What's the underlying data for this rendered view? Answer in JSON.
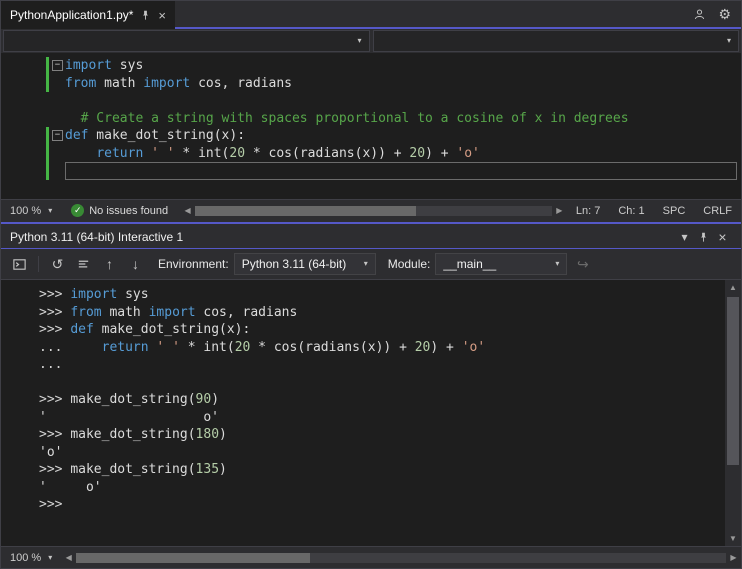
{
  "colors": {
    "accent": "#5558c8",
    "chrome": "#2d2d30",
    "editor_bg": "#1e1e1e",
    "border": "#3f3f46",
    "keyword": "#569cd6",
    "string": "#d69d85",
    "number": "#b5cea8",
    "comment": "#57a64a",
    "code_text": "#dcdcdc",
    "status_green": "#388a34",
    "change_bar": "#45b545"
  },
  "glyphs": {
    "caret_down": "▾",
    "close": "×",
    "gear": "⚙",
    "reset": "↺",
    "arrow_up": "↑",
    "arrow_down": "↓",
    "send_arrow": "↪",
    "scroll_left": "◀",
    "scroll_right": "▶",
    "scroll_up": "▲",
    "scroll_down": "▼",
    "check": "✓",
    "fold_collapse": "−"
  },
  "editor_tab": {
    "title": "PythonApplication1.py*"
  },
  "editor": {
    "lines": [
      {
        "fold": true,
        "changed": true,
        "tokens": [
          [
            "k",
            "import"
          ],
          [
            "d",
            " sys"
          ]
        ]
      },
      {
        "changed": true,
        "tokens": [
          [
            "k",
            "from"
          ],
          [
            "d",
            " math "
          ],
          [
            "k",
            "import"
          ],
          [
            "d",
            " cos, radians"
          ]
        ]
      },
      {
        "tokens": []
      },
      {
        "tokens": [
          [
            "c",
            "  # Create a string with spaces proportional to a cosine of x in degrees"
          ]
        ]
      },
      {
        "fold": true,
        "changed": true,
        "tokens": [
          [
            "k",
            "def"
          ],
          [
            "d",
            " make_dot_string(x):"
          ]
        ]
      },
      {
        "changed": true,
        "tokens": [
          [
            "d",
            "    "
          ],
          [
            "k",
            "return"
          ],
          [
            "d",
            " "
          ],
          [
            "s",
            "' '"
          ],
          [
            "d",
            " * int("
          ],
          [
            "n",
            "20"
          ],
          [
            "d",
            " * cos(radians(x)) + "
          ],
          [
            "n",
            "20"
          ],
          [
            "d",
            ") + "
          ],
          [
            "s",
            "'o'"
          ]
        ]
      },
      {
        "changed": true,
        "caretBox": true,
        "tokens": []
      }
    ],
    "status": {
      "zoom": "100 %",
      "issues_message": "No issues found",
      "line": "Ln: 7",
      "column": "Ch: 1",
      "indent_mode": "SPC",
      "line_ending": "CRLF"
    }
  },
  "interactive": {
    "title": "Python 3.11 (64-bit) Interactive 1",
    "toolbar": {
      "environment_label": "Environment:",
      "environment_value": "Python 3.11 (64-bit)",
      "module_label": "Module:",
      "module_value": "__main__"
    },
    "lines": [
      {
        "tokens": [
          [
            "p",
            ">>> "
          ],
          [
            "k",
            "import"
          ],
          [
            "d",
            " sys"
          ]
        ]
      },
      {
        "tokens": [
          [
            "p",
            ">>> "
          ],
          [
            "k",
            "from"
          ],
          [
            "d",
            " math "
          ],
          [
            "k",
            "import"
          ],
          [
            "d",
            " cos, radians"
          ]
        ]
      },
      {
        "tokens": [
          [
            "p",
            ">>> "
          ],
          [
            "k",
            "def"
          ],
          [
            "d",
            " make_dot_string(x):"
          ]
        ]
      },
      {
        "tokens": [
          [
            "p",
            "... "
          ],
          [
            "d",
            "    "
          ],
          [
            "k",
            "return"
          ],
          [
            "d",
            " "
          ],
          [
            "s",
            "' '"
          ],
          [
            "d",
            " * int("
          ],
          [
            "n",
            "20"
          ],
          [
            "d",
            " * cos(radians(x)) + "
          ],
          [
            "n",
            "20"
          ],
          [
            "d",
            ") + "
          ],
          [
            "s",
            "'o'"
          ]
        ]
      },
      {
        "tokens": [
          [
            "p",
            "..."
          ]
        ]
      },
      {
        "tokens": []
      },
      {
        "tokens": [
          [
            "p",
            ">>> "
          ],
          [
            "d",
            "make_dot_string("
          ],
          [
            "n",
            "90"
          ],
          [
            "d",
            ")"
          ]
        ]
      },
      {
        "tokens": [
          [
            "d",
            "'                    o'"
          ]
        ]
      },
      {
        "tokens": [
          [
            "p",
            ">>> "
          ],
          [
            "d",
            "make_dot_string("
          ],
          [
            "n",
            "180"
          ],
          [
            "d",
            ")"
          ]
        ]
      },
      {
        "tokens": [
          [
            "d",
            "'o'"
          ]
        ]
      },
      {
        "tokens": [
          [
            "p",
            ">>> "
          ],
          [
            "d",
            "make_dot_string("
          ],
          [
            "n",
            "135"
          ],
          [
            "d",
            ")"
          ]
        ]
      },
      {
        "tokens": [
          [
            "d",
            "'     o'"
          ]
        ]
      },
      {
        "tokens": [
          [
            "p",
            ">>>"
          ]
        ]
      }
    ],
    "status": {
      "zoom": "100 %"
    }
  }
}
